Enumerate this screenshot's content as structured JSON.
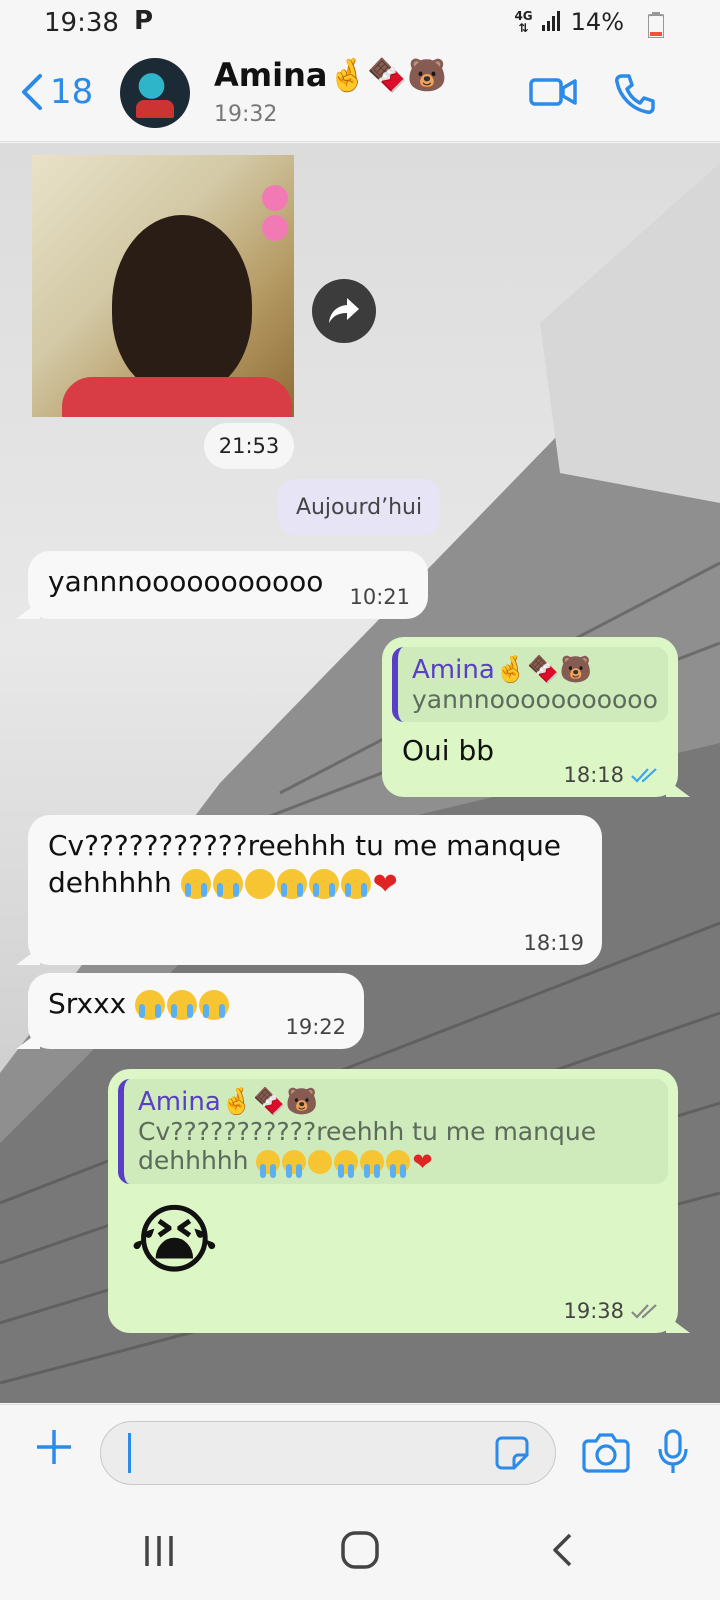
{
  "status_bar": {
    "time": "19:38",
    "notification": "P",
    "network": "4G",
    "battery": "14%"
  },
  "header": {
    "back_count": "18",
    "contact_name": "Amina🤞🍫🐻",
    "last_seen": "19:32",
    "icons": [
      "back-chevron-icon",
      "video-call-icon",
      "phone-icon"
    ]
  },
  "chat": {
    "media_time": "21:53",
    "date_label": "Aujourd’hui",
    "messages": [
      {
        "side": "in",
        "text": "yannnooooooooooo",
        "time": "10:21"
      },
      {
        "side": "out",
        "quote_name": "Amina🤞🍫🐻",
        "quote_text": "yannnooooooooooo",
        "text": "Oui bb",
        "time": "18:18",
        "status": "read"
      },
      {
        "side": "in",
        "text_line1": "Cv???????????reehhh tu me manque",
        "text_line2": "dehhhhh",
        "time": "18:19"
      },
      {
        "side": "in",
        "text": "Srxxx",
        "time": "19:22"
      },
      {
        "side": "out",
        "quote_name": "Amina🤞🍫🐻",
        "quote_line1": "Cv???????????reehhh tu me manque",
        "quote_line2": "dehhhhh",
        "text": "😭",
        "time": "19:38",
        "status": "delivered"
      }
    ]
  },
  "composer": {
    "placeholder": "",
    "icons": [
      "plus-icon",
      "sticker-icon",
      "camera-icon",
      "microphone-icon"
    ]
  },
  "colors": {
    "accent": "#2c8ae8",
    "outgoing_bubble": "#dcf7c5",
    "incoming_bubble": "#f8f8f8",
    "quote_bar": "#5a3fc6"
  }
}
